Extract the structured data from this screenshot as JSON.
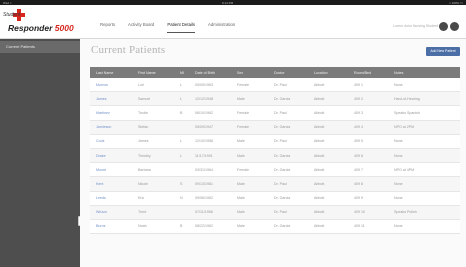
{
  "statusbar": {
    "left": "iPad ≈",
    "center": "9:14 PM",
    "right": "≈ 100% ▭"
  },
  "logo": {
    "top_text": "Student",
    "brand_name": "Responder",
    "brand_number": "5000"
  },
  "nav": {
    "items": [
      "Reports",
      "Activity Board",
      "Patient Details",
      "Administration"
    ],
    "active": "Patient Details"
  },
  "user": {
    "text": "Lorem dolor Nursing Student"
  },
  "sidebar": {
    "items": [
      "Current Patients"
    ]
  },
  "collapse_glyph": "‹",
  "page": {
    "title": "Current Patients",
    "add_button": "Add New Patient"
  },
  "table": {
    "columns": [
      "Last Name",
      "First Name",
      "MI",
      "Date of Birth",
      "Sex",
      "Doctor",
      "Location",
      "Room/Bed",
      "Notes"
    ],
    "rows": [
      [
        "Morrow",
        "Lori",
        "L",
        "05/05/1963",
        "Female",
        "Dr. Paul",
        "Abbott",
        "409 1",
        "None"
      ],
      [
        "James",
        "Samuel",
        "L",
        "12/12/1948",
        "Male",
        "Dr. Garcia",
        "Abbott",
        "409 2",
        "Hard-of-Hearing"
      ],
      [
        "Martinez",
        "Trudie",
        "B",
        "08/10/1962",
        "Female",
        "Dr. Paul",
        "Abbott",
        "409 3",
        "Speaks Spanish"
      ],
      [
        "Jamieson",
        "Stefan",
        "",
        "05/09/1947",
        "Female",
        "Dr. Garcia",
        "Abbott",
        "409 4",
        "NPO at 2PM"
      ],
      [
        "Cook",
        "James",
        "L",
        "12/10/1958",
        "Male",
        "Dr. Paul",
        "Abbott",
        "409 5",
        "None"
      ],
      [
        "Drake",
        "Timothy",
        "L",
        "11/17/1991",
        "Male",
        "Dr. Garcia",
        "Abbott",
        "409 6",
        "None"
      ],
      [
        "Moore",
        "Barbara",
        "",
        "03/31/1964",
        "Female",
        "Dr. Garcia",
        "Abbott",
        "409 7",
        "NPO at 4PM"
      ],
      [
        "Kent",
        "Nicole",
        "S",
        "09/13/1981",
        "Male",
        "Dr. Paul",
        "Abbott",
        "409 8",
        "None"
      ],
      [
        "Leeds",
        "Eric",
        "N",
        "09/06/1962",
        "Male",
        "Dr. Garcia",
        "Abbott",
        "409 9",
        "None"
      ],
      [
        "Wrizzo",
        "Trent",
        "",
        "07/11/1958",
        "Male",
        "Dr. Paul",
        "Abbott",
        "409 10",
        "Speaks Polish"
      ],
      [
        "Burns",
        "Noah",
        "B",
        "08/22/1962",
        "Male",
        "Dr. Garcia",
        "Abbott",
        "409 11",
        "None"
      ]
    ]
  },
  "colors": {
    "accent": "#4c6ea6",
    "brand_red": "#d7261e",
    "sidebar": "#4e4e4e",
    "table_header": "#7b7b7b",
    "link": "#6f8fc7"
  }
}
